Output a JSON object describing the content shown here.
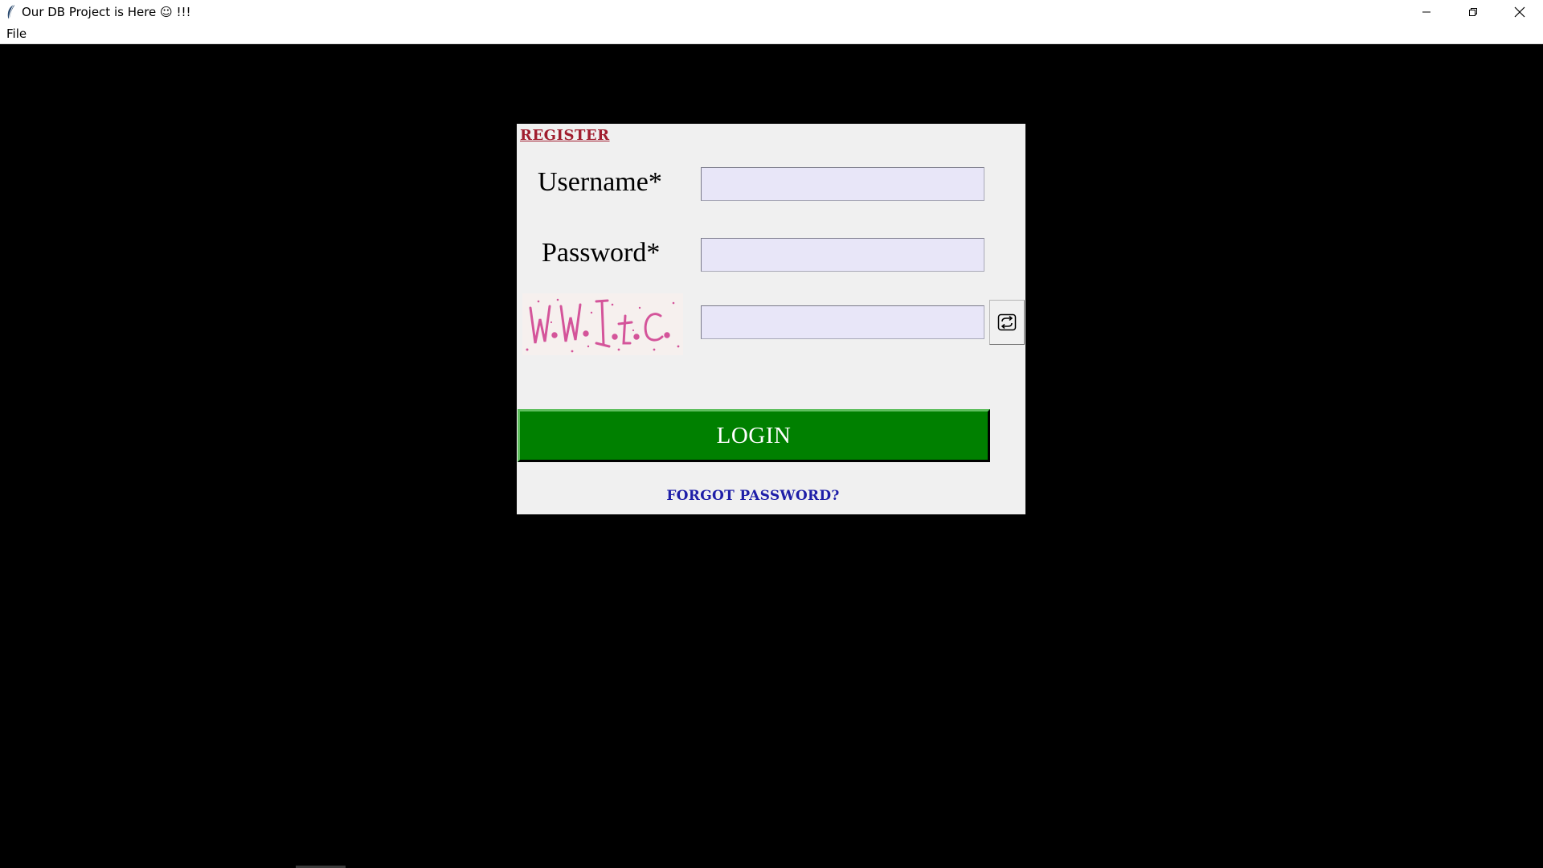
{
  "window": {
    "title": "Our DB Project is Here ☺ !!!",
    "controls": {
      "minimize": "minimize-icon",
      "maximize": "restore-icon",
      "close": "close-icon"
    }
  },
  "menubar": {
    "items": [
      {
        "label": "File"
      }
    ]
  },
  "login_form": {
    "register_label": "REGISTER",
    "username_label": "Username*",
    "username_value": "",
    "password_label": "Password*",
    "password_value": "",
    "captcha_input_value": "",
    "captcha_image": "captcha-image",
    "refresh_icon": "refresh-icon",
    "login_label": "LOGIN",
    "forgot_label": "FORGOT PASSWORD?"
  },
  "colors": {
    "background": "#000000",
    "panel": "#f0f0f0",
    "input_bg": "#e8e6f8",
    "login_button": "#008000",
    "register_link": "#a01d2e",
    "forgot_link": "#1f1fa8",
    "captcha_ink": "#d4549a"
  }
}
